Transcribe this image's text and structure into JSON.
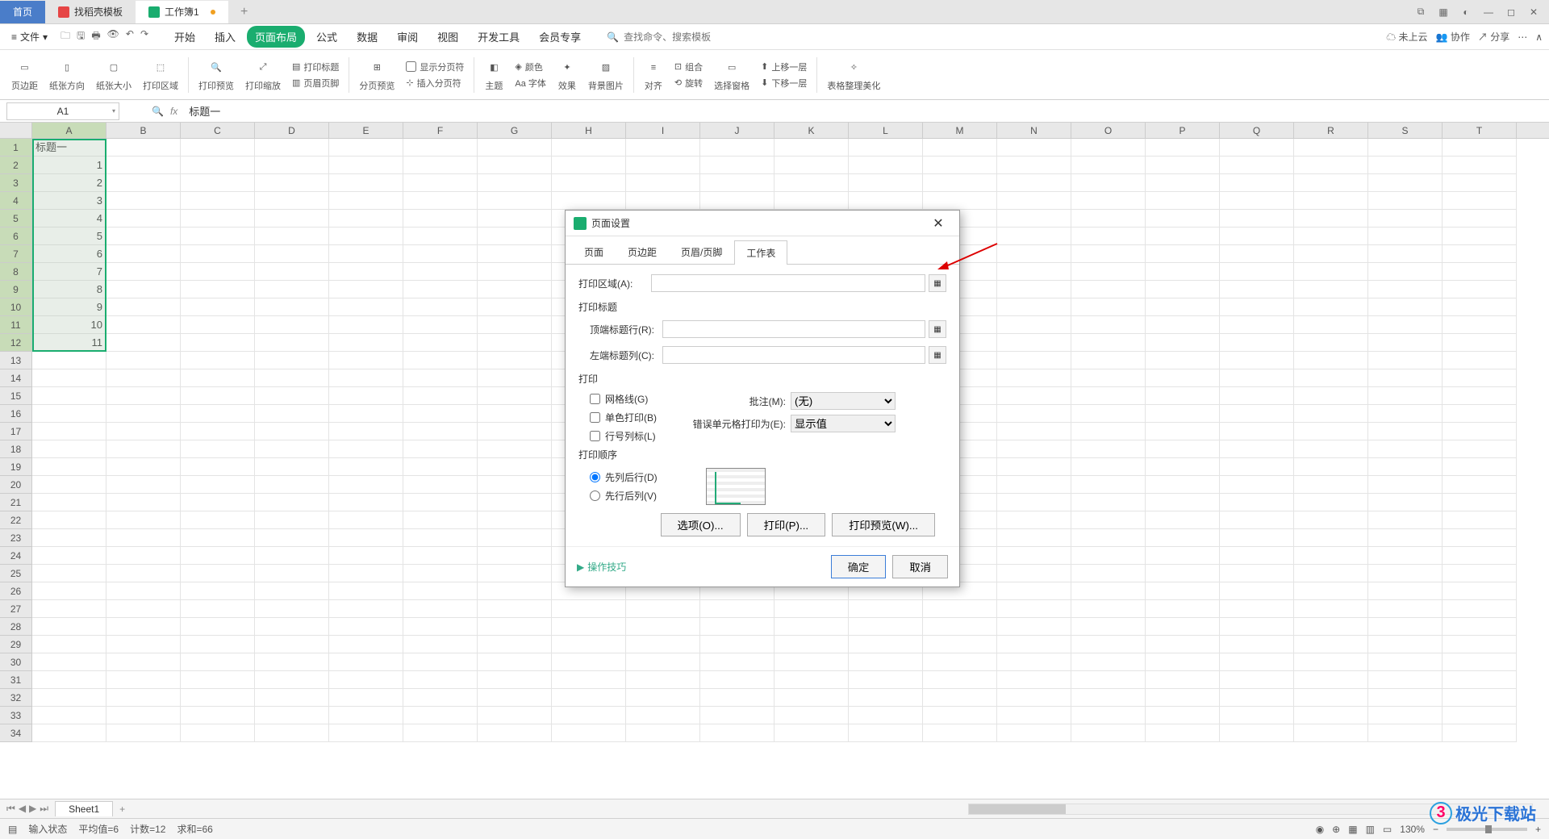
{
  "tabs": {
    "home": "首页",
    "template": "找稻壳模板",
    "workbook": "工作簿1"
  },
  "menu": {
    "file": "文件",
    "tabs": [
      "开始",
      "插入",
      "页面布局",
      "公式",
      "数据",
      "审阅",
      "视图",
      "开发工具",
      "会员专享"
    ],
    "active_index": 2,
    "search_hint": "查找命令、搜索模板",
    "search_prefix": "查找命令,",
    "cloud": "未上云",
    "coop": "协作",
    "share": "分享"
  },
  "ribbon": {
    "margins": "页边距",
    "orientation": "纸张方向",
    "size": "纸张大小",
    "print_area": "打印区域",
    "print_preview": "打印预览",
    "print_scale": "打印缩放",
    "print_titles": "打印标题",
    "header_footer": "页眉页脚",
    "show_breaks": "显示分页符",
    "breaks": "分页预览",
    "insert_break": "插入分页符",
    "theme": "主题",
    "color": "颜色",
    "font": "Aa 字体",
    "effect": "效果",
    "bg": "背景图片",
    "align": "对齐",
    "group": "组合",
    "rotate": "旋转",
    "pane": "选择窗格",
    "up": "上移一层",
    "down": "下移一层",
    "beautify": "表格整理美化"
  },
  "formula": {
    "cell_ref": "A1",
    "value": "标题一"
  },
  "columns": [
    "A",
    "B",
    "C",
    "D",
    "E",
    "F",
    "G",
    "H",
    "I",
    "J",
    "K",
    "L",
    "M",
    "N",
    "O",
    "P",
    "Q",
    "R",
    "S",
    "T"
  ],
  "row_count": 34,
  "col_a_data": [
    "标题一",
    "1",
    "2",
    "3",
    "4",
    "5",
    "6",
    "7",
    "8",
    "9",
    "10",
    "11"
  ],
  "sheet": {
    "name": "Sheet1"
  },
  "status": {
    "mode": "输入状态",
    "avg_label": "平均值=",
    "avg": "6",
    "count_label": "计数=",
    "count": "12",
    "sum_label": "求和=",
    "sum": "66",
    "zoom": "130%"
  },
  "dialog": {
    "title": "页面设置",
    "tabs": [
      "页面",
      "页边距",
      "页眉/页脚",
      "工作表"
    ],
    "active_tab": 3,
    "print_area_label": "打印区域(A):",
    "print_titles_label": "打印标题",
    "top_row_label": "顶端标题行(R):",
    "left_col_label": "左端标题列(C):",
    "print_label": "打印",
    "gridlines": "网格线(G)",
    "bw": "单色打印(B)",
    "rowcol": "行号列标(L)",
    "comments_label": "批注(M):",
    "comments_value": "(无)",
    "errors_label": "错误单元格打印为(E):",
    "errors_value": "显示值",
    "order_label": "打印顺序",
    "order1": "先列后行(D)",
    "order2": "先行后列(V)",
    "options": "选项(O)...",
    "print": "打印(P)...",
    "preview": "打印预览(W)...",
    "tips": "操作技巧",
    "ok": "确定",
    "cancel": "取消"
  },
  "watermark": "极光下载站"
}
